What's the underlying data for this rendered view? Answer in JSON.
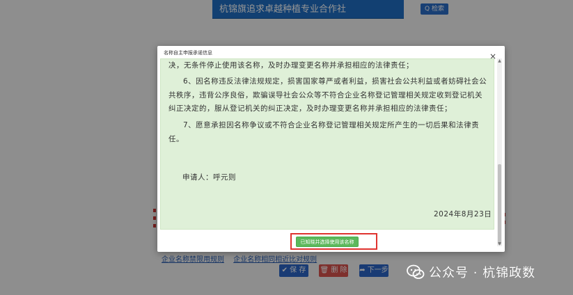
{
  "background": {
    "top_field_text": "杭锦旗追求卓越种植专业合作社",
    "search_button": "Q 检索",
    "links": [
      "企业名称禁限用规则",
      "企业名称相同相近比对规则"
    ],
    "buttons": {
      "save": "✔ 保 存",
      "delete": "🗑 删 除",
      "next": "➦ 下一步"
    }
  },
  "dialog": {
    "title": "名称自主申报承诺信息",
    "close_label": "×",
    "paragraph_top": "决，无条件停止使用该名称，及时办理变更名称并承担相应的法律责任；",
    "paragraph_6": "6、因名称违反法律法规规定，损害国家尊严或者利益，损害社会公共利益或者妨碍社会公共秩序，违背公序良俗，欺骗误导社会公众等不符合企业名称登记管理相关规定收到登记机关纠正决定的，服从登记机关的纠正决定，及时办理变更名称并承担相应的法律责任；",
    "paragraph_7": "7、愿意承担因名称争议或不符合企业名称登记管理相关规定所产生的一切后果和法律责任。",
    "applicant": "申请人：呼元则",
    "date": "2024年8月23日",
    "confirm_button": "已知晓并选择使用该名称"
  },
  "watermark": {
    "text": "公众号 · 杭锦政数",
    "icon": "wechat-icon"
  },
  "colors": {
    "primary": "#1f6fc5",
    "content_bg": "#dff0d8",
    "confirm_green": "#5cb85c",
    "highlight_red": "#e0332f",
    "danger": "#d9534f"
  }
}
